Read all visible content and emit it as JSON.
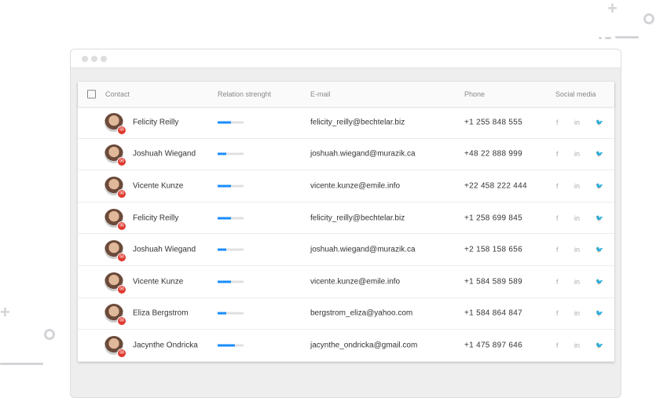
{
  "window": {
    "controls": [
      "close",
      "minimize",
      "maximize"
    ]
  },
  "table": {
    "headers": {
      "contact": "Contact",
      "relation": "Relation strenght",
      "email": "E-mail",
      "phone": "Phone",
      "social": "Social media"
    },
    "social_icons": {
      "facebook": "f",
      "linkedin": "in",
      "twitter": "🐦"
    },
    "rows": [
      {
        "name": "Felicity Reilly",
        "relation": 0.5,
        "email": "felicity_reilly@bechtelar.biz",
        "phone": "+1 255 848 555"
      },
      {
        "name": "Joshuah Wiegand",
        "relation": 0.33,
        "email": "joshuah.wiegand@murazik.ca",
        "phone": "+48 22 888 999"
      },
      {
        "name": "Vicente Kunze",
        "relation": 0.5,
        "email": "vicente.kunze@emile.info",
        "phone": "+22 458 222 444"
      },
      {
        "name": "Felicity Reilly",
        "relation": 0.5,
        "email": "felicity_reilly@bechtelar.biz",
        "phone": "+1 258 699 845"
      },
      {
        "name": "Joshuah Wiegand",
        "relation": 0.33,
        "email": "joshuah.wiegand@murazik.ca",
        "phone": "+2 158 158 656"
      },
      {
        "name": "Vicente Kunze",
        "relation": 0.5,
        "email": "vicente.kunze@emile.info",
        "phone": "+1 584 589 589"
      },
      {
        "name": "Eliza Bergstrom",
        "relation": 0.33,
        "email": "bergstrom_eliza@yahoo.com",
        "phone": "+1 584 864 847"
      },
      {
        "name": "Jacynthe Ondricka",
        "relation": 0.67,
        "email": "jacynthe_ondricka@gmail.com",
        "phone": "+1 475 897 646"
      }
    ]
  },
  "colors": {
    "accent": "#1a8cff",
    "badge": "#e03a2f"
  }
}
